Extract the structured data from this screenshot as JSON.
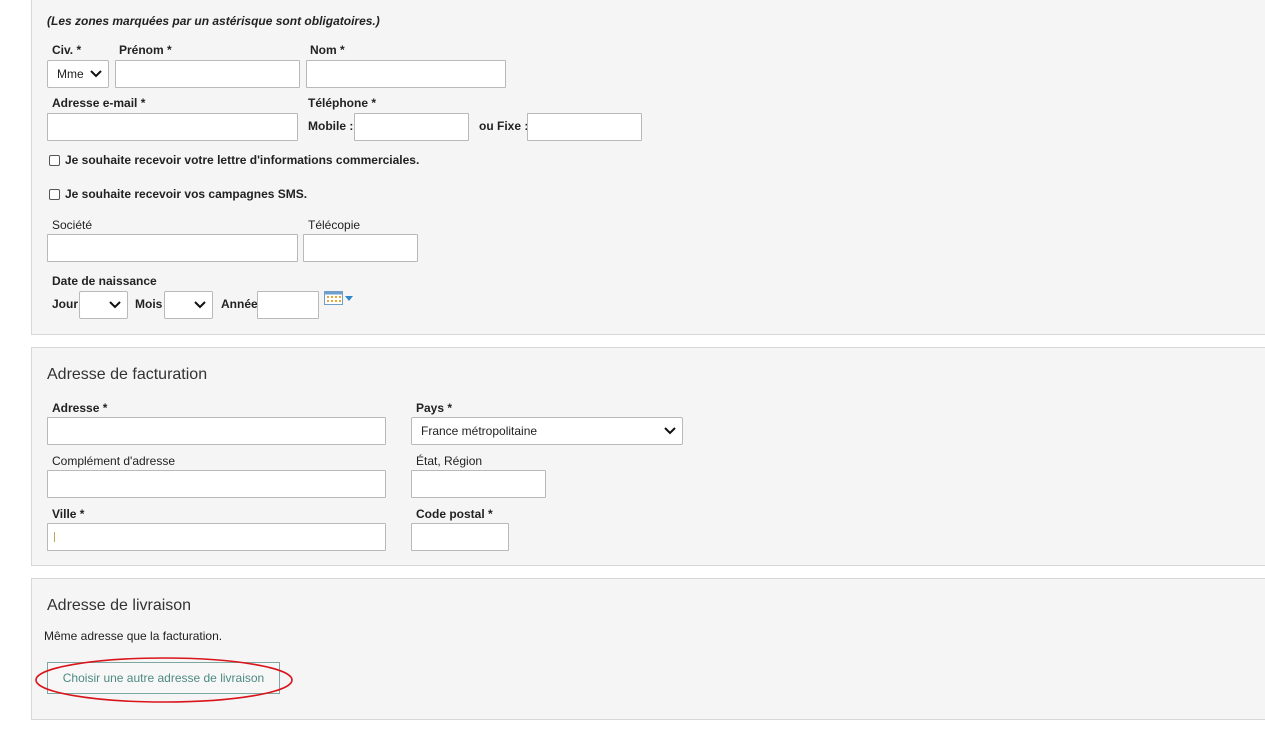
{
  "identity": {
    "required_note": "(Les zones marquées par un astérisque sont obligatoires.)",
    "civ_label": "Civ. *",
    "civ_value": "Mme",
    "firstname_label": "Prénom *",
    "lastname_label": "Nom *",
    "email_label": "Adresse e-mail *",
    "phone_label": "Téléphone *",
    "mobile_label": "Mobile :",
    "fixe_label": "ou Fixe :",
    "newsletter_label": "Je souhaite recevoir votre lettre d'informations commerciales.",
    "sms_label": "Je souhaite recevoir vos campagnes SMS.",
    "company_label": "Société",
    "fax_label": "Télécopie",
    "birthdate_label": "Date de naissance",
    "day_label": "Jour",
    "month_label": "Mois",
    "year_label": "Année"
  },
  "billing": {
    "title": "Adresse de facturation",
    "address_label": "Adresse *",
    "country_label": "Pays *",
    "country_value": "France métropolitaine",
    "complement_label": "Complément d'adresse",
    "region_label": "État, Région",
    "city_label": "Ville *",
    "postal_label": "Code postal *"
  },
  "shipping": {
    "title": "Adresse de livraison",
    "same_text": "Même adresse que la facturation.",
    "other_button": "Choisir une autre adresse de livraison"
  },
  "colors": {
    "annotation": "#d9151b",
    "button_text": "#4e8a83"
  }
}
